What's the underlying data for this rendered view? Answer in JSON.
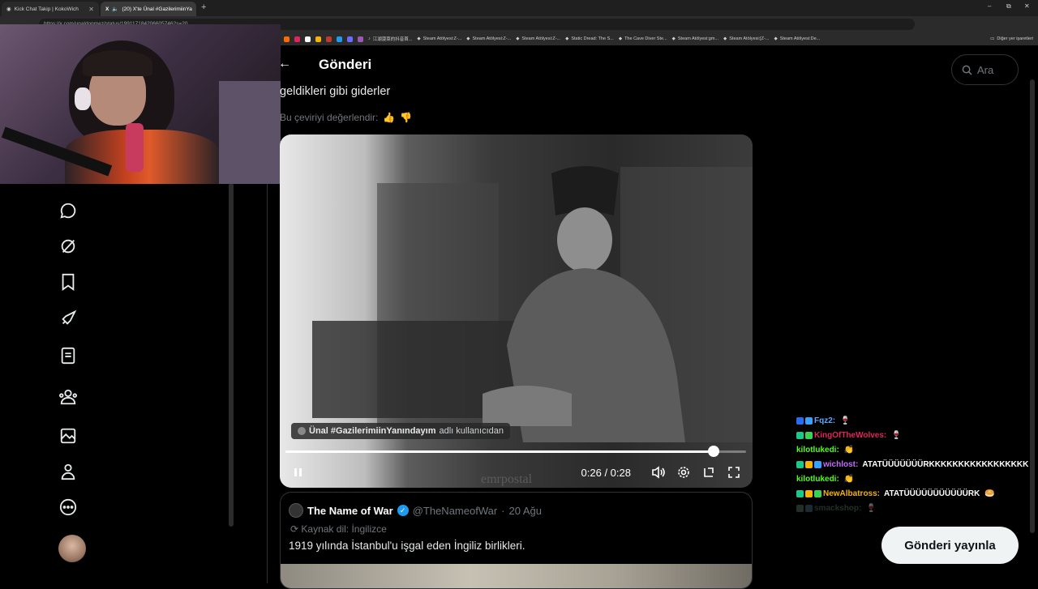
{
  "browser": {
    "tabs": [
      {
        "title": "Kick Chat Takip | KokoWich"
      },
      {
        "title": "(20) X'te Ünal #GazilerimiinYa"
      }
    ],
    "new_tab": "+",
    "window_controls": [
      "–",
      "⧉",
      "✕"
    ],
    "url": "https://x.com/unaldonmez/status/1991171842066057462s=20",
    "bookmarks": [
      "江湖菠菜的抖音首...",
      "Steam Atölyesi:Z-...",
      "Steam Atölyesi:Z-...",
      "Steam Atölyesi:Z-...",
      "Static Dread: The S...",
      "The Cave Diver Ste...",
      "Steam Atölyesi:gm...",
      "Steam Atölyesi:[Z-...",
      "Steam Atölyesi:De..."
    ],
    "bookmarks_other": "Diğer yer işaretleri"
  },
  "nav": {
    "icons": [
      "chat-icon",
      "grok-icon",
      "bookmark-icon",
      "rocket-icon",
      "list-icon",
      "communities-icon",
      "media-icon",
      "profile-icon",
      "more-icon"
    ]
  },
  "header": {
    "title": "Gönderi",
    "back": "←"
  },
  "tweet": {
    "text": "geldikleri gibi giderler",
    "rate_translation": "Bu çeviriyi değerlendir:"
  },
  "video": {
    "attribution_name": "Ünal #GazilerimiinYanındayım",
    "attribution_suffix": "adlı kullanıcıdan",
    "time": "0:26 / 0:28",
    "progress": 0.93
  },
  "quote": {
    "name": "The Name of War",
    "handle": "@TheNameofWar",
    "date": "20 Ağu",
    "source_lang": "Kaynak dil: İngilizce",
    "text": "1919 yılında İstanbul'u işgal eden İngiliz birlikleri."
  },
  "search": {
    "placeholder": "Ara"
  },
  "chat": [
    {
      "user": "Fqz2:",
      "msg": "",
      "color": "#5aa9ff",
      "badges": [
        "#2a6cf0",
        "#3aa0ff"
      ],
      "emote": "🍷"
    },
    {
      "user": "KingOfTheWolves:",
      "msg": "",
      "color": "#e0245e",
      "badges": [
        "#18c98a",
        "#39d353"
      ],
      "emote": "🍷"
    },
    {
      "user": "kilotlukedi:",
      "msg": "",
      "color": "#53fc18",
      "badges": [],
      "emote": "👏"
    },
    {
      "user": "wichlost:",
      "msg": "ATATÜÜÜÜÜÜÜRKKKKKKKKKKKKKKKKK",
      "color": "#c46cff",
      "badges": [
        "#18c98a",
        "#f5b400",
        "#3aa0ff"
      ],
      "emote": ""
    },
    {
      "user": "kilotlukedi:",
      "msg": "",
      "color": "#53fc18",
      "badges": [],
      "emote": "👏"
    },
    {
      "user": "NewAlbatross:",
      "msg": "ATATÜÜÜÜÜÜÜÜÜÜÜRK",
      "color": "#f5b400",
      "badges": [
        "#18c98a",
        "#f5b400",
        "#39d353"
      ],
      "emote": "🥯"
    },
    {
      "user": "smackshop:",
      "msg": "",
      "color": "#4a6b58",
      "badges": [
        "#4a6b58",
        "#3a6070"
      ],
      "emote": "🍷"
    }
  ],
  "publish": {
    "label": "Gönderi yayınla"
  },
  "colors": {
    "accent": "#1d9bf0",
    "bg": "#000000",
    "border": "#2f3336"
  }
}
